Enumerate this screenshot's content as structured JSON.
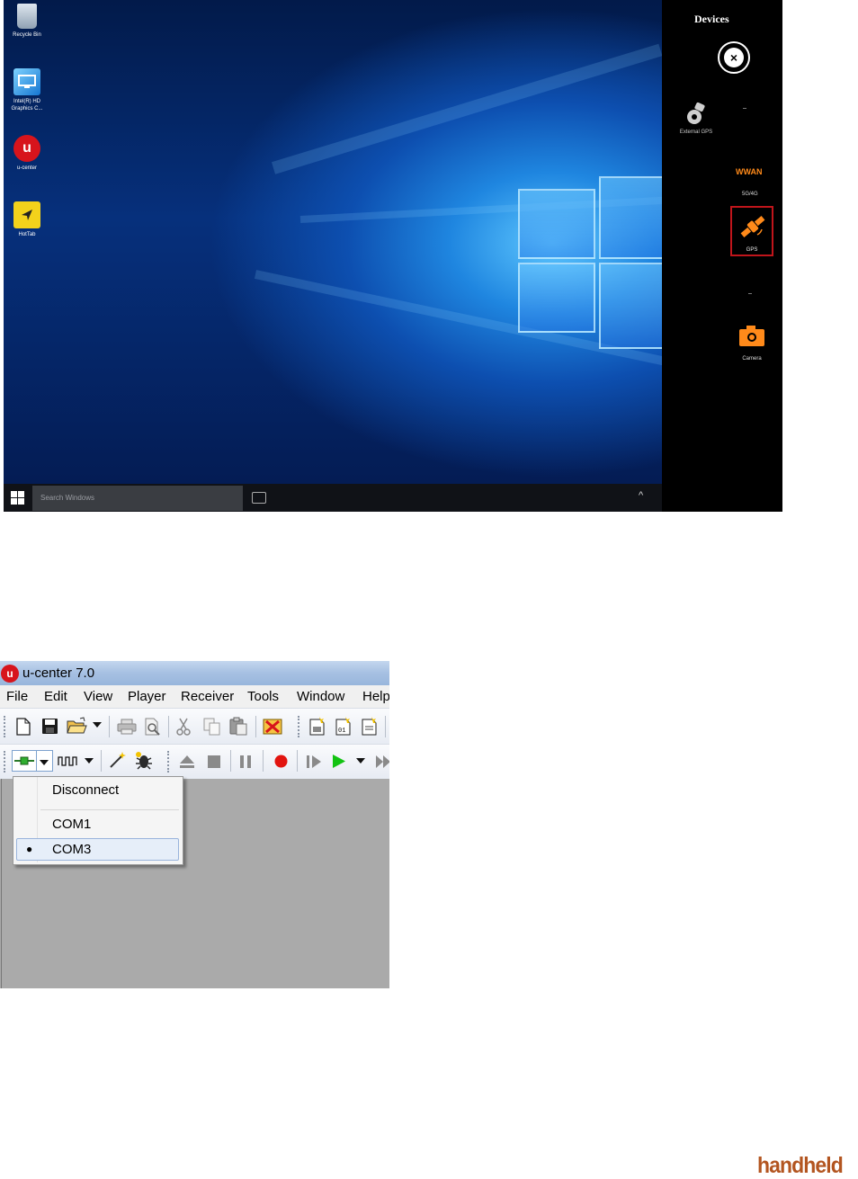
{
  "win10_screen": {
    "desktop_icons": [
      {
        "label": "Recycle Bin",
        "icon": "recycle-bin-icon"
      },
      {
        "label": "Intel(R) HD Graphics C...",
        "icon": "intel-graphics-icon"
      },
      {
        "label": "u-center",
        "icon": "u-center-app-icon"
      },
      {
        "label": "HotTab",
        "icon": "hottab-icon"
      }
    ],
    "taskbar": {
      "search_placeholder": "Search Windows"
    },
    "devices_panel": {
      "title": "Devices",
      "external_gps_label": "External GPS",
      "wwan_label": "WWAN",
      "network_label": "5G/4G",
      "gps_label": "GPS",
      "camera_label": "Camera",
      "highlight_color": "#c0151b",
      "accent_color": "#ff8a1a"
    }
  },
  "ucenter": {
    "title": "u-center 7.0",
    "menu": [
      "File",
      "Edit",
      "View",
      "Player",
      "Receiver",
      "Tools",
      "Window",
      "Help"
    ],
    "connection_menu": {
      "items": [
        "Disconnect",
        "COM1",
        "COM3"
      ],
      "selected": "COM3"
    }
  },
  "brand": {
    "logo_text": "handheld",
    "color": "#b35520"
  }
}
